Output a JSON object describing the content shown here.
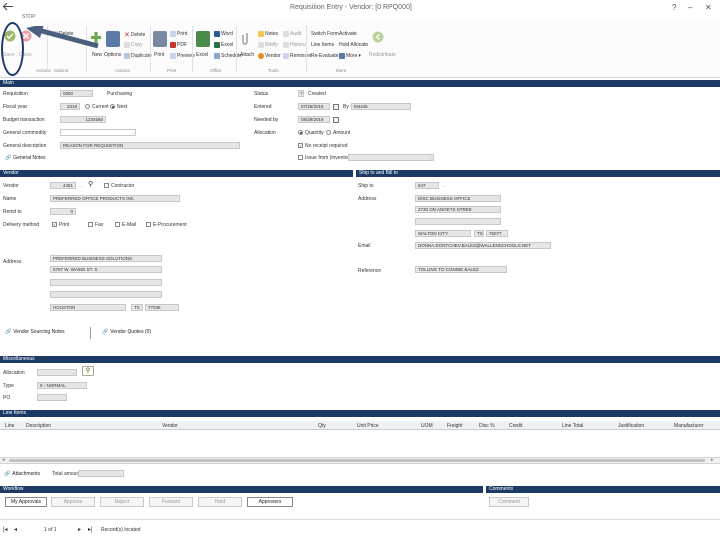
{
  "window": {
    "title": "Requisition Entry - Vendor: [0 RPQ000]",
    "nav_label": "STOP",
    "help_icon": "?",
    "minimize_icon": "–",
    "close_icon": "✕"
  },
  "ribbon": {
    "actions": {
      "save": "Save",
      "close": "Close",
      "group": "Actions"
    },
    "submit": {
      "label": "Delete",
      "group": "Submit"
    },
    "new": {
      "new": "New",
      "copy": "Copy",
      "duplicate": "Duplicate",
      "delete": "Delete",
      "options": "Options",
      "group": "Actions"
    },
    "print": {
      "print": "Print",
      "pdf": "PDF",
      "preview": "Preview",
      "group": "Print"
    },
    "office": {
      "word": "Word",
      "excel": "Excel",
      "schedule": "Schedule",
      "group": "Office"
    },
    "tools": {
      "attach": "Attach",
      "notes": "Notes",
      "notify": "Notify",
      "audit": "Audit",
      "history": "History",
      "vendor": "Vendor",
      "reminder": "Reminder",
      "group": "Tools"
    },
    "more": {
      "switch_form": "Switch Form",
      "line_items": "Line Items",
      "re_evaluate": "Re-Evaluate",
      "redistribute": "Redistribute",
      "activate": "Activate",
      "hold_allocate": "Hold Allocate",
      "more": "More",
      "group": "More"
    }
  },
  "main": {
    "header": "Main",
    "requisition_label": "Requisition",
    "requisition_value": "0050",
    "requisition_type": "Purchasing",
    "fiscal_year_label": "Fiscal year",
    "fiscal_year_value": "2018",
    "current_label": "Current",
    "next_label": "Next",
    "budget_transaction_label": "Budget transaction",
    "budget_transaction_value": "1234560",
    "general_commodity_label": "General commodity",
    "general_description_label": "General description",
    "general_description_value": "REASON FOR REQUISITION",
    "general_notes_link": "General Notes",
    "status_label": "Status",
    "status_value": "Created",
    "entered_label": "Entered",
    "entered_value": "07/25/2019",
    "by_label": "By",
    "by_value": "M4445",
    "by_date_label": "Fiscal Year",
    "needed_by_label": "Needed by",
    "needed_by_value": "08/29/2019",
    "allocation_label": "Allocation",
    "quantity_label": "Quantity",
    "amount_label": "Amount",
    "no_receipt_label": "No receipt required",
    "issue_from_label": "Issue from (inventory) 10",
    "issue_from_value": ""
  },
  "vendor": {
    "header": "Vendor",
    "vendor_label": "Vendor",
    "vendor_value": "4451",
    "contractor_label": "Contractor",
    "name_label": "Name",
    "name_value": "PREFERRED OFFICE PRODUCTS INC",
    "remit_label": "Remit to",
    "remit_value": "0",
    "delivery_label": "Delivery method",
    "print_label": "Print",
    "fax_label": "Fax",
    "email_label": "E-Mail",
    "ep_label": "E-Procurement",
    "address_label": "Address",
    "address_lines": [
      "PREFERRED BUSINESS SOLUTIONS",
      "5797 W. WAINE ST. S",
      "",
      ""
    ],
    "city_value": "HOUSTON",
    "state_value": "TX",
    "zip_value": "77036",
    "sourcing_notes_link": "Vendor Sourcing Notes",
    "quotes_link": "Vendor Quotes (0)"
  },
  "ship_bill": {
    "header": "Ship to and Bill to",
    "ship_to_label": "Ship to",
    "ship_to_value": "547",
    "address_label": "Address",
    "address_lines": [
      "DISC BUSINESS OFFICE",
      "2730 ON ANGETS STREE",
      "",
      "WALTON CITY"
    ],
    "state_value": "TX",
    "zip_value": "75077",
    "email_label": "Email",
    "email_value": "DONNA.DONTCHEV.BALEZ@WALLENSCHOOLS.NET",
    "reference_label": "Reference",
    "reference_value": "TOLLING TO CONNIE BALEZ"
  },
  "miscellaneous": {
    "header": "Miscellaneous",
    "allocation_label": "Allocation",
    "type_label": "Type",
    "type_value": "0 - NORMAL",
    "po_label": "PO"
  },
  "line_items": {
    "header": "Line Items",
    "columns": [
      "Line",
      "Description",
      "Vendor",
      "Qty",
      "Unit Price",
      "UOM",
      "Freight",
      "Disc %",
      "Credit",
      "Line Total",
      "Justification",
      "Manufacturer"
    ],
    "attachments_label": "Attachments",
    "total_amount_label": "Total amount"
  },
  "workflow": {
    "header": "Workflow",
    "buttons": [
      "My Approvals",
      "Approve",
      "Reject",
      "Forward",
      "Hold",
      "Approvers"
    ],
    "comments_header": "Comments",
    "comments_button": "Comment"
  },
  "pager": {
    "page_value": "1 of 1",
    "record_text": "Record(s) located"
  },
  "colors": {
    "section_header": "#1d3a66",
    "annotation": "#1e3a6b"
  }
}
